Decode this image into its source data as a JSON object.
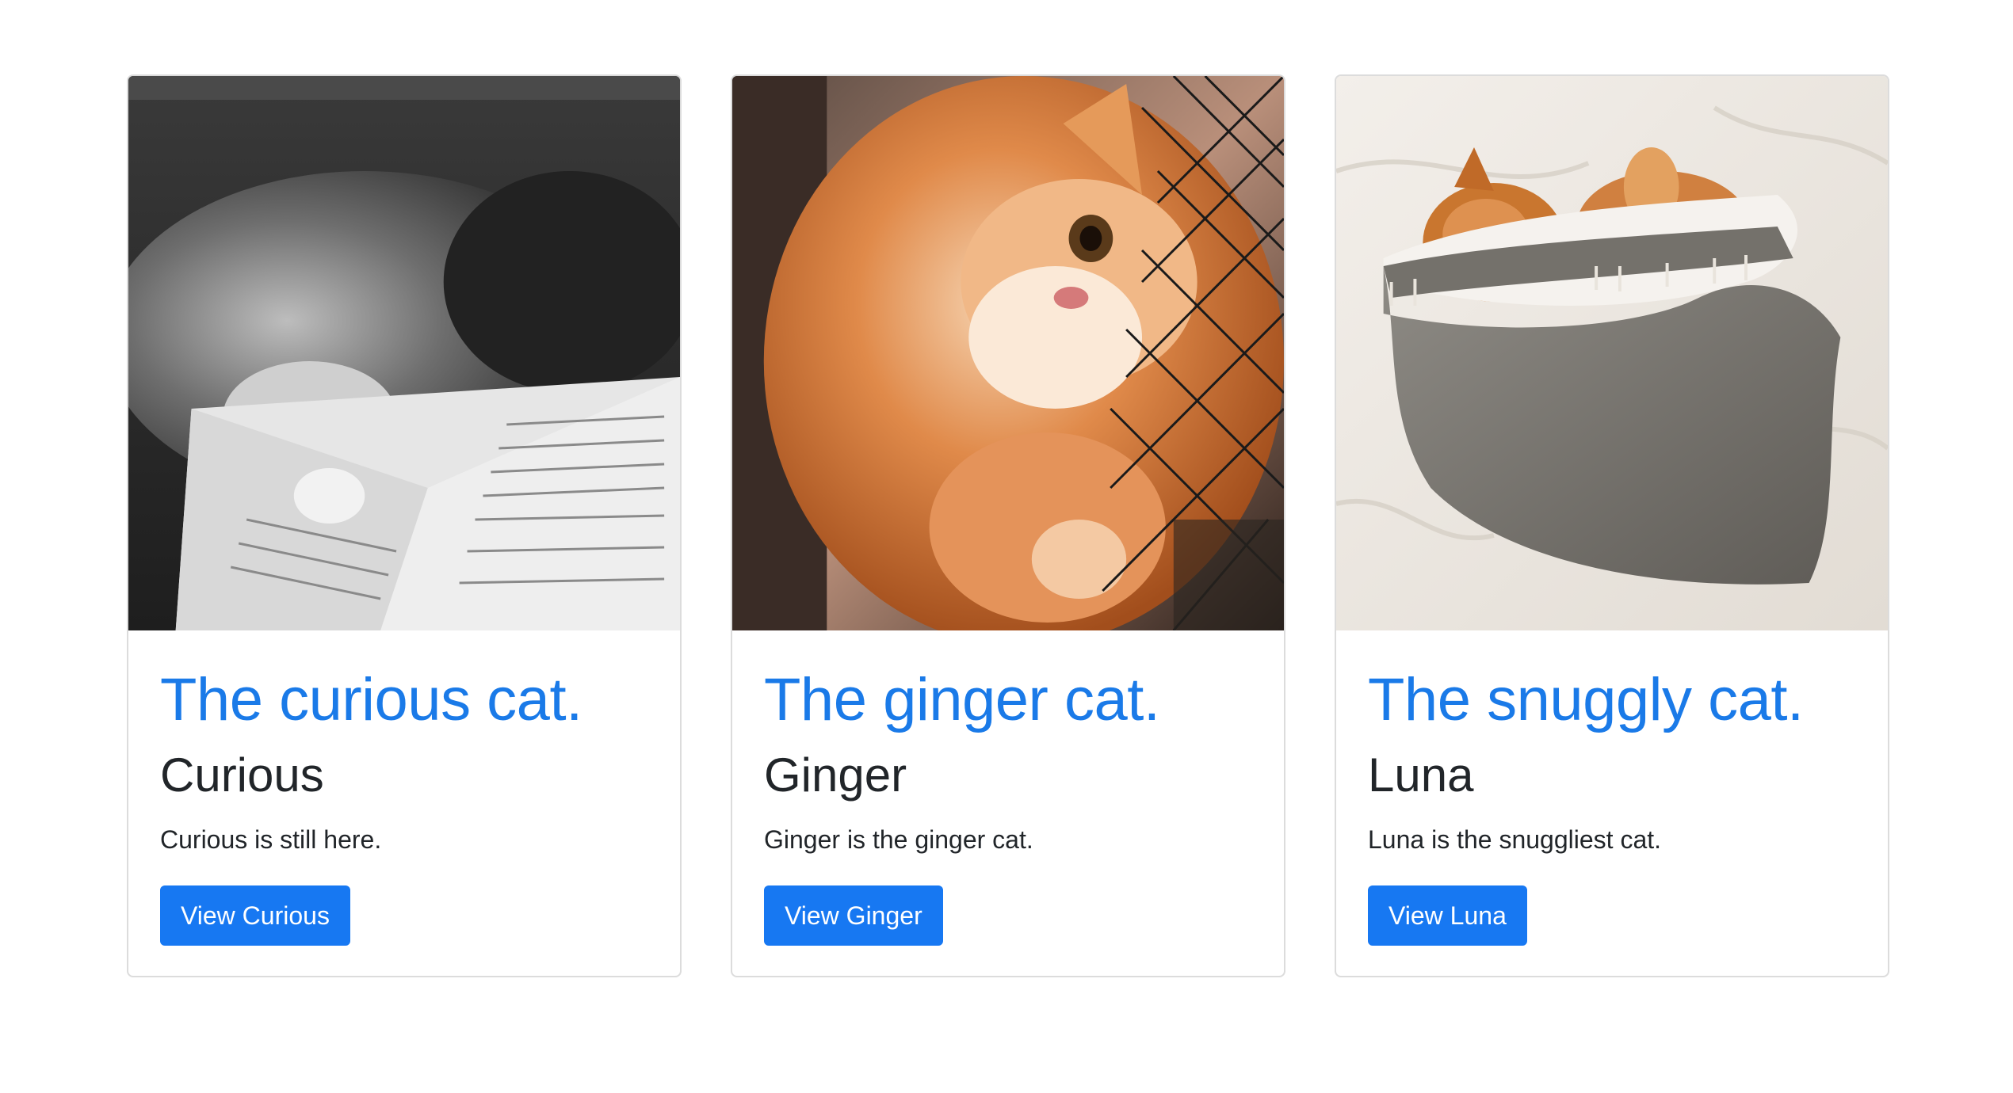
{
  "cards": [
    {
      "title": "The curious cat.",
      "name": "Curious",
      "text": "Curious is still here.",
      "button_label": "View Curious"
    },
    {
      "title": "The ginger cat.",
      "name": "Ginger",
      "text": "Ginger is the ginger cat.",
      "button_label": "View Ginger"
    },
    {
      "title": "The snuggly cat.",
      "name": "Luna",
      "text": "Luna is the snuggliest cat.",
      "button_label": "View Luna"
    }
  ],
  "colors": {
    "title_blue": "#1a7ae8",
    "button_blue": "#1778f2",
    "text_dark": "#212529",
    "card_border": "#dcdcdc"
  }
}
